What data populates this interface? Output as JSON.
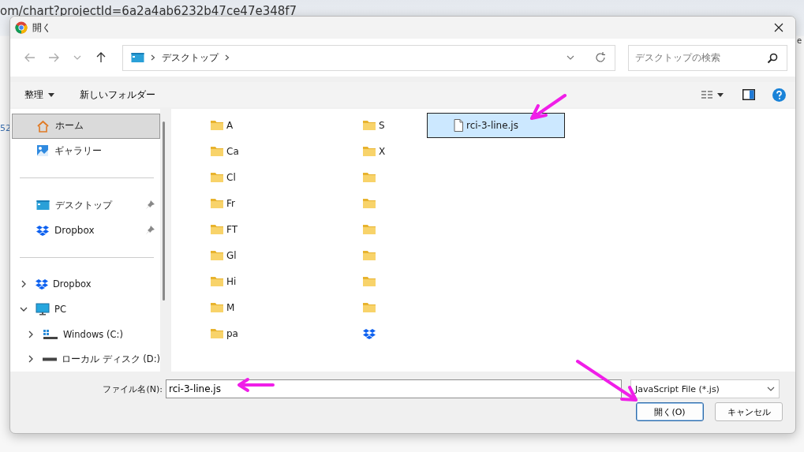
{
  "background_page": {
    "url": "om/chart?projectId=6a2a4ab6232b47ce47e348f7",
    "left_fragment": "52",
    "right_fragment": "e"
  },
  "dialog": {
    "title": "開く"
  },
  "address_bar": {
    "path": [
      "デスクトップ"
    ]
  },
  "search": {
    "placeholder": "デスクトップの検索"
  },
  "toolbar": {
    "organize": "整理",
    "new_folder": "新しいフォルダー"
  },
  "sidebar": {
    "groups": [
      {
        "items": [
          {
            "label": "ホーム",
            "kind": "home",
            "selected": true,
            "pinned": false
          },
          {
            "label": "ギャラリー",
            "kind": "gallery",
            "selected": false,
            "pinned": false
          }
        ]
      },
      {
        "items": [
          {
            "label": "デスクトップ",
            "kind": "desktop",
            "selected": false,
            "pinned": true
          },
          {
            "label": "Dropbox",
            "kind": "dropbox",
            "selected": false,
            "pinned": true
          }
        ]
      },
      {
        "tree": [
          {
            "label": "Dropbox",
            "kind": "dropbox",
            "expanded": false
          },
          {
            "label": "PC",
            "kind": "pc",
            "expanded": true,
            "children": [
              {
                "label": "Windows (C:)",
                "kind": "windows-drive",
                "expanded": false
              },
              {
                "label": "ローカル ディスク (D:)",
                "kind": "drive",
                "expanded": false
              }
            ]
          }
        ]
      }
    ]
  },
  "files": {
    "columns": [
      {
        "items": [
          {
            "name": "A",
            "kind": "folder",
            "selected": false
          },
          {
            "name": "Ca",
            "kind": "folder",
            "selected": false
          },
          {
            "name": "Cl",
            "kind": "folder",
            "selected": false
          },
          {
            "name": "Fr",
            "kind": "folder",
            "selected": false
          },
          {
            "name": "FT",
            "kind": "folder",
            "selected": false
          },
          {
            "name": "Gl",
            "kind": "folder",
            "selected": false
          },
          {
            "name": "Hi",
            "kind": "folder",
            "selected": false
          },
          {
            "name": "M",
            "kind": "folder",
            "selected": false
          },
          {
            "name": "pa",
            "kind": "folder",
            "selected": false
          }
        ]
      },
      {
        "items": [
          {
            "name": "S",
            "kind": "folder",
            "selected": false
          },
          {
            "name": "X",
            "kind": "folder",
            "selected": false
          },
          {
            "kind": "folder",
            "selected": false
          },
          {
            "kind": "folder",
            "selected": false
          },
          {
            "kind": "folder",
            "selected": false
          },
          {
            "kind": "folder",
            "selected": false
          },
          {
            "kind": "folder",
            "selected": false
          },
          {
            "kind": "folder",
            "selected": false
          },
          {
            "kind": "dropbox",
            "selected": false
          }
        ]
      },
      {
        "items": [
          {
            "name": "rci-3-line.js",
            "kind": "file",
            "selected": true
          }
        ]
      }
    ]
  },
  "file_name": {
    "label": "ファイル名(N):",
    "value": "rci-3-line.js"
  },
  "file_type": {
    "value": "JavaScript File (*.js)"
  },
  "buttons": [
    {
      "label": "開く(O)",
      "kind": "primary"
    },
    {
      "label": "キャンセル",
      "kind": "secondary"
    }
  ],
  "annotations": [
    {
      "kind": "arrow"
    },
    {
      "kind": "arrow"
    },
    {
      "kind": "arrow"
    }
  ]
}
